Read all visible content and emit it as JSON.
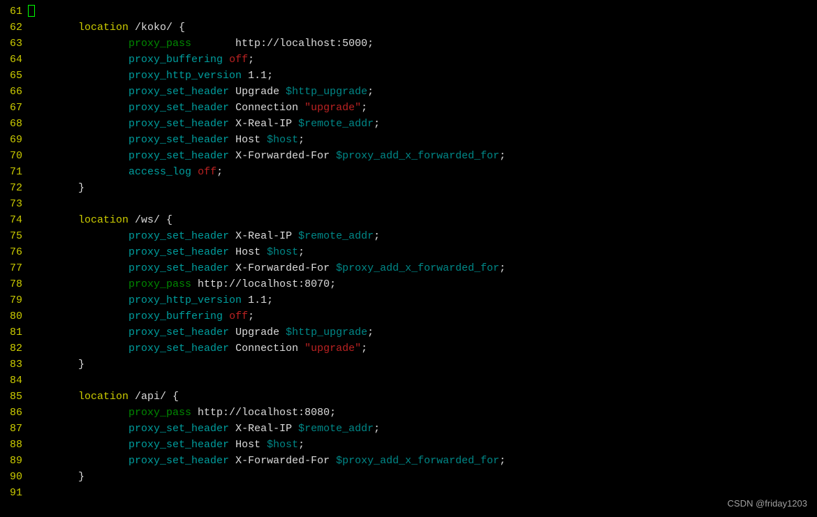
{
  "colors": {
    "keyword": "#cccc00",
    "directive": "#009e9e",
    "green": "#008800",
    "string": "#bb2222",
    "variable": "#008888",
    "plain": "#dcdcdc"
  },
  "watermark": "CSDN @friday1203",
  "lines": [
    {
      "num": 61,
      "indent": "",
      "tokens": [
        {
          "t": "cursor"
        }
      ]
    },
    {
      "num": 62,
      "indent": "        ",
      "tokens": [
        {
          "t": "kw",
          "v": "location"
        },
        {
          "t": "pl",
          "v": " /koko/ {"
        }
      ]
    },
    {
      "num": 63,
      "indent": "                ",
      "tokens": [
        {
          "t": "grn",
          "v": "proxy_pass"
        },
        {
          "t": "pl",
          "v": "       http://localhost:5000;"
        }
      ]
    },
    {
      "num": 64,
      "indent": "                ",
      "tokens": [
        {
          "t": "dir",
          "v": "proxy_buffering"
        },
        {
          "t": "pl",
          "v": " "
        },
        {
          "t": "str",
          "v": "off"
        },
        {
          "t": "pl",
          "v": ";"
        }
      ]
    },
    {
      "num": 65,
      "indent": "                ",
      "tokens": [
        {
          "t": "dir",
          "v": "proxy_http_version"
        },
        {
          "t": "pl",
          "v": " 1.1;"
        }
      ]
    },
    {
      "num": 66,
      "indent": "                ",
      "tokens": [
        {
          "t": "dir",
          "v": "proxy_set_header"
        },
        {
          "t": "pl",
          "v": " Upgrade "
        },
        {
          "t": "var",
          "v": "$http_upgrade"
        },
        {
          "t": "pl",
          "v": ";"
        }
      ]
    },
    {
      "num": 67,
      "indent": "                ",
      "tokens": [
        {
          "t": "dir",
          "v": "proxy_set_header"
        },
        {
          "t": "pl",
          "v": " Connection "
        },
        {
          "t": "str",
          "v": "\"upgrade\""
        },
        {
          "t": "pl",
          "v": ";"
        }
      ]
    },
    {
      "num": 68,
      "indent": "                ",
      "tokens": [
        {
          "t": "dir",
          "v": "proxy_set_header"
        },
        {
          "t": "pl",
          "v": " X-Real-IP "
        },
        {
          "t": "var",
          "v": "$remote_addr"
        },
        {
          "t": "pl",
          "v": ";"
        }
      ]
    },
    {
      "num": 69,
      "indent": "                ",
      "tokens": [
        {
          "t": "dir",
          "v": "proxy_set_header"
        },
        {
          "t": "pl",
          "v": " Host "
        },
        {
          "t": "var",
          "v": "$host"
        },
        {
          "t": "pl",
          "v": ";"
        }
      ]
    },
    {
      "num": 70,
      "indent": "                ",
      "tokens": [
        {
          "t": "dir",
          "v": "proxy_set_header"
        },
        {
          "t": "pl",
          "v": " X-Forwarded-For "
        },
        {
          "t": "var",
          "v": "$proxy_add_x_forwarded_for"
        },
        {
          "t": "pl",
          "v": ";"
        }
      ]
    },
    {
      "num": 71,
      "indent": "                ",
      "tokens": [
        {
          "t": "dir",
          "v": "access_log"
        },
        {
          "t": "pl",
          "v": " "
        },
        {
          "t": "str",
          "v": "off"
        },
        {
          "t": "pl",
          "v": ";"
        }
      ]
    },
    {
      "num": 72,
      "indent": "        ",
      "tokens": [
        {
          "t": "pl",
          "v": "}"
        }
      ]
    },
    {
      "num": 73,
      "indent": "",
      "tokens": []
    },
    {
      "num": 74,
      "indent": "        ",
      "tokens": [
        {
          "t": "kw",
          "v": "location"
        },
        {
          "t": "pl",
          "v": " /ws/ {"
        }
      ]
    },
    {
      "num": 75,
      "indent": "                ",
      "tokens": [
        {
          "t": "dir",
          "v": "proxy_set_header"
        },
        {
          "t": "pl",
          "v": " X-Real-IP "
        },
        {
          "t": "var",
          "v": "$remote_addr"
        },
        {
          "t": "pl",
          "v": ";"
        }
      ]
    },
    {
      "num": 76,
      "indent": "                ",
      "tokens": [
        {
          "t": "dir",
          "v": "proxy_set_header"
        },
        {
          "t": "pl",
          "v": " Host "
        },
        {
          "t": "var",
          "v": "$host"
        },
        {
          "t": "pl",
          "v": ";"
        }
      ]
    },
    {
      "num": 77,
      "indent": "                ",
      "tokens": [
        {
          "t": "dir",
          "v": "proxy_set_header"
        },
        {
          "t": "pl",
          "v": " X-Forwarded-For "
        },
        {
          "t": "var",
          "v": "$proxy_add_x_forwarded_for"
        },
        {
          "t": "pl",
          "v": ";"
        }
      ]
    },
    {
      "num": 78,
      "indent": "                ",
      "tokens": [
        {
          "t": "grn",
          "v": "proxy_pass"
        },
        {
          "t": "pl",
          "v": " http://localhost:8070;"
        }
      ]
    },
    {
      "num": 79,
      "indent": "                ",
      "tokens": [
        {
          "t": "dir",
          "v": "proxy_http_version"
        },
        {
          "t": "pl",
          "v": " 1.1;"
        }
      ]
    },
    {
      "num": 80,
      "indent": "                ",
      "tokens": [
        {
          "t": "dir",
          "v": "proxy_buffering"
        },
        {
          "t": "pl",
          "v": " "
        },
        {
          "t": "str",
          "v": "off"
        },
        {
          "t": "pl",
          "v": ";"
        }
      ]
    },
    {
      "num": 81,
      "indent": "                ",
      "tokens": [
        {
          "t": "dir",
          "v": "proxy_set_header"
        },
        {
          "t": "pl",
          "v": " Upgrade "
        },
        {
          "t": "var",
          "v": "$http_upgrade"
        },
        {
          "t": "pl",
          "v": ";"
        }
      ]
    },
    {
      "num": 82,
      "indent": "                ",
      "tokens": [
        {
          "t": "dir",
          "v": "proxy_set_header"
        },
        {
          "t": "pl",
          "v": " Connection "
        },
        {
          "t": "str",
          "v": "\"upgrade\""
        },
        {
          "t": "pl",
          "v": ";"
        }
      ]
    },
    {
      "num": 83,
      "indent": "        ",
      "tokens": [
        {
          "t": "pl",
          "v": "}"
        }
      ]
    },
    {
      "num": 84,
      "indent": "",
      "tokens": []
    },
    {
      "num": 85,
      "indent": "        ",
      "tokens": [
        {
          "t": "kw",
          "v": "location"
        },
        {
          "t": "pl",
          "v": " /api/ {"
        }
      ]
    },
    {
      "num": 86,
      "indent": "                ",
      "tokens": [
        {
          "t": "grn",
          "v": "proxy_pass"
        },
        {
          "t": "pl",
          "v": " http://localhost:8080;"
        }
      ]
    },
    {
      "num": 87,
      "indent": "                ",
      "tokens": [
        {
          "t": "dir",
          "v": "proxy_set_header"
        },
        {
          "t": "pl",
          "v": " X-Real-IP "
        },
        {
          "t": "var",
          "v": "$remote_addr"
        },
        {
          "t": "pl",
          "v": ";"
        }
      ]
    },
    {
      "num": 88,
      "indent": "                ",
      "tokens": [
        {
          "t": "dir",
          "v": "proxy_set_header"
        },
        {
          "t": "pl",
          "v": " Host "
        },
        {
          "t": "var",
          "v": "$host"
        },
        {
          "t": "pl",
          "v": ";"
        }
      ]
    },
    {
      "num": 89,
      "indent": "                ",
      "tokens": [
        {
          "t": "dir",
          "v": "proxy_set_header"
        },
        {
          "t": "pl",
          "v": " X-Forwarded-For "
        },
        {
          "t": "var",
          "v": "$proxy_add_x_forwarded_for"
        },
        {
          "t": "pl",
          "v": ";"
        }
      ]
    },
    {
      "num": 90,
      "indent": "        ",
      "tokens": [
        {
          "t": "pl",
          "v": "}"
        }
      ]
    },
    {
      "num": 91,
      "indent": "",
      "tokens": []
    }
  ]
}
